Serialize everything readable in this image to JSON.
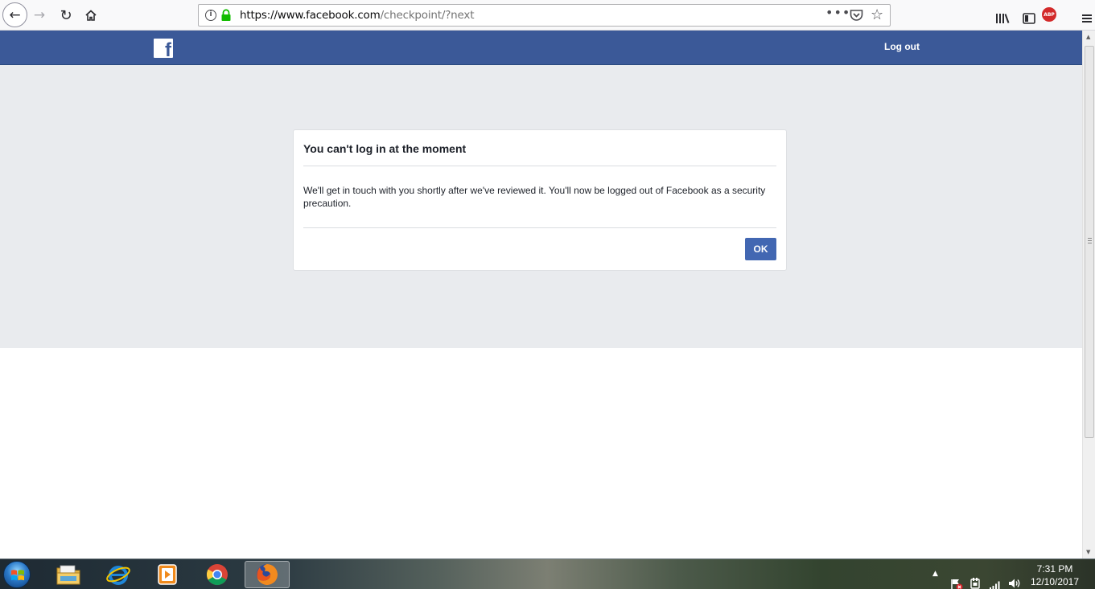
{
  "browser": {
    "url_host": "https://www.facebook.com",
    "url_path": "/checkpoint/?next",
    "abp_label": "ABP",
    "page_actions_label": "•••"
  },
  "header": {
    "logo_letter": "f",
    "logout_label": "Log out",
    "brand_color": "#3b5998"
  },
  "dialog": {
    "title": "You can't log in at the moment",
    "body": "We'll get in touch with you shortly after we've reviewed it. You'll now be logged out of Facebook as a security precaution.",
    "ok_label": "OK",
    "button_color": "#4267b2"
  },
  "taskbar": {
    "apps": [
      "start-orb",
      "windows-explorer",
      "internet-explorer",
      "media-player",
      "google-chrome",
      "firefox"
    ],
    "active_app": "firefox",
    "time": "7:31 PM",
    "date": "12/10/2017"
  }
}
